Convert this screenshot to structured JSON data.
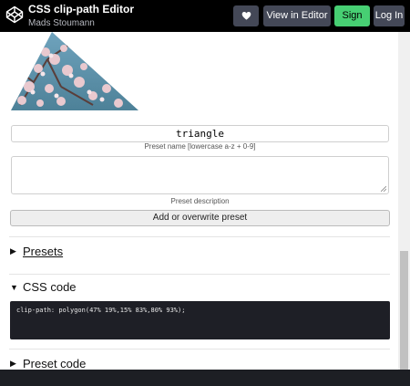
{
  "header": {
    "title": "CSS clip-path Editor",
    "author": "Mads Stoumann",
    "view_in_editor_label": "View in Editor",
    "signup_label": "Sign Up",
    "login_label": "Log In"
  },
  "form": {
    "preset_name_value": "triangle",
    "preset_name_caption": "Preset name [lowercase a-z + 0-9]",
    "preset_description_value": "",
    "preset_description_caption": "Preset description",
    "add_button_label": "Add or overwrite preset"
  },
  "sections": {
    "presets_label": "Presets",
    "css_code_label": "CSS code",
    "css_code_text": "clip-path: polygon(47% 19%,15% 83%,80% 93%);",
    "preset_code_label": "Preset code"
  },
  "colors": {
    "topbar": "#000000",
    "button_dark": "#444857",
    "signup_green": "#47cf73",
    "code_bg": "#1e1f26"
  },
  "icons": {
    "logo": "codepen-logo-icon",
    "heart": "heart-icon",
    "expanded": "triangle-down-icon",
    "collapsed": "triangle-right-icon"
  }
}
